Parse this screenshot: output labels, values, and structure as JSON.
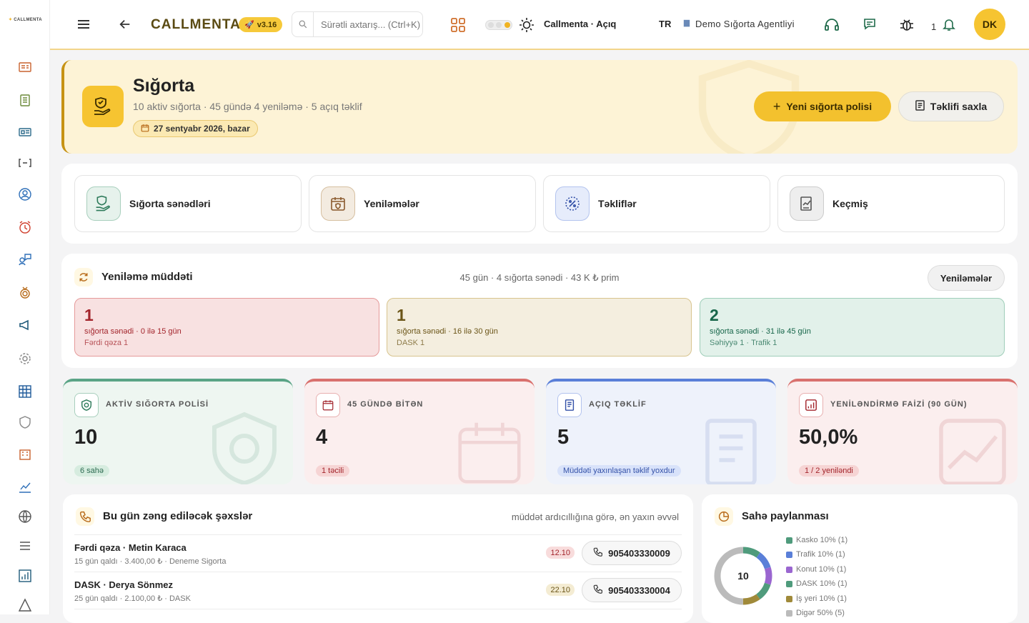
{
  "app": {
    "logo": "CALLMENTA",
    "brand": "CALLMENTA",
    "version": "v3.16",
    "search_placeholder": "Sürətli axtarış... (Ctrl+K)",
    "status": "Callmenta · Açıq",
    "lang": "TR",
    "company": "Demo Sığorta Agentliyi",
    "notif_count": "1",
    "avatar": "DK"
  },
  "page": {
    "title": "Sığorta",
    "subtitle": "10 aktiv sığorta · 45 gündə 4 yenilәmә · 5 açıq tәklif",
    "date": "27 sentyabr 2026, bazar",
    "primary_btn": "Yeni sığorta polisi",
    "secondary_btn": "Tәklifi saxla"
  },
  "quick": [
    {
      "label": "Sığorta sәnәdlәri",
      "color": "#4f9b7c"
    },
    {
      "label": "Yenilәmәlәr",
      "color": "#a07050"
    },
    {
      "label": "Tәkliflәr",
      "color": "#4f6fd0"
    },
    {
      "label": "Keçmiş",
      "color": "#666"
    }
  ],
  "renewal": {
    "title": "Yenilәmә müddәti",
    "meta": "45 gün · 4 sığorta sәnәdi · 43 K ₺ prim",
    "button": "Yenilәmәlәr",
    "cards": [
      {
        "count": "1",
        "line1": "sığorta sәnәdi · 0 ilә 15 gün",
        "line2": "Fәrdi qәza 1",
        "bg": "#f8e1e1",
        "border": "#e59a9a",
        "color": "#a3252c"
      },
      {
        "count": "1",
        "line1": "sığorta sәnәdi · 16 ilә 30 gün",
        "line2": "DASK 1",
        "bg": "#f4eedf",
        "border": "#d8c48e",
        "color": "#6b5518"
      },
      {
        "count": "2",
        "line1": "sığorta sәnәdi · 31 ilә 45 gün",
        "line2": "Sәhiyyә 1 · Trafik 1",
        "bg": "#e2f1ea",
        "border": "#9fceb9",
        "color": "#17664a"
      }
    ]
  },
  "stats": [
    {
      "title": "AKTİV SIĞORTA POLİSİ",
      "value": "10",
      "badge": "6 sahә",
      "accent": "#5aa486",
      "bg": "#eef6f1",
      "badge_bg": "#d6ecdf",
      "badge_color": "#2d6b52"
    },
    {
      "title": "45 GÜNDӘ BİTӘN",
      "value": "4",
      "badge": "1 tәcili",
      "accent": "#d9716e",
      "bg": "#fbeeee",
      "badge_bg": "#f6d4d4",
      "badge_color": "#a3252c"
    },
    {
      "title": "AÇIQ TӘKLİF",
      "value": "5",
      "badge": "Müddәti yaxınlaşan tәklif yoxdur",
      "accent": "#5a7fd8",
      "bg": "#eef2fb",
      "badge_bg": "#d8e2fa",
      "badge_color": "#3552a8"
    },
    {
      "title": "YENİLӘNDİRMӘ FAİZİ (90 GÜN)",
      "value": "50,0%",
      "badge": "1 / 2 yenilәndi",
      "accent": "#d9716e",
      "bg": "#fbeeee",
      "badge_bg": "#f6d4d4",
      "badge_color": "#a3252c"
    }
  ],
  "calls": {
    "title": "Bu gün zәng edilәcәk şәxslәr",
    "sort": "müddәt ardıcıllığına görә, әn yaxın әvvәl",
    "rows": [
      {
        "title": "Fәrdi qәza · Metin Karaca",
        "sub": "15 gün qaldı · 3.400,00 ₺ · Deneme Sigorta",
        "date": "12.10",
        "phone": "905403330009",
        "date_bg": "#f8dcdc",
        "date_color": "#a3252c"
      },
      {
        "title": "DASK · Derya Sönmez",
        "sub": "25 gün qaldı · 2.100,00 ₺ · DASK",
        "date": "22.10",
        "phone": "905403330004",
        "date_bg": "#f4ecd3",
        "date_color": "#6b5518"
      }
    ]
  },
  "dist": {
    "title": "Sahә paylanması",
    "total": "10",
    "items": [
      {
        "label": "Kasko 10% (1)",
        "color": "#4f9b7c",
        "pct": 10
      },
      {
        "label": "Trafik 10% (1)",
        "color": "#5a7fd8",
        "pct": 10
      },
      {
        "label": "Konut 10% (1)",
        "color": "#9a66d0",
        "pct": 10
      },
      {
        "label": "DASK 10% (1)",
        "color": "#4f9b7c",
        "pct": 10
      },
      {
        "label": "İş yeri 10% (1)",
        "color": "#a08a3a",
        "pct": 10
      },
      {
        "label": "Digәr 50% (5)",
        "color": "#bbbbbb",
        "pct": 50
      }
    ]
  }
}
